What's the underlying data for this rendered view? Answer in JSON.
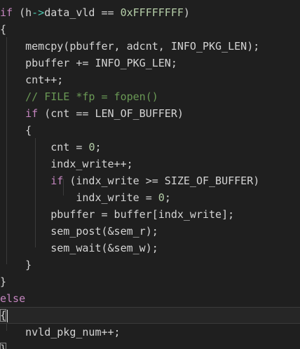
{
  "editor": {
    "lines": [
      {
        "kw": "if",
        "text": " (h",
        "arrow": "->",
        "text2": "data_vld == ",
        "num": "0xFFFFFFFF",
        "text3": ")"
      },
      {
        "text": "{"
      },
      {
        "text": "    memcpy(pbuffer, adcnt, INFO_PKG_LEN);"
      },
      {
        "text": "    pbuffer += INFO_PKG_LEN;"
      },
      {
        "text": "    cnt++;"
      },
      {
        "comment": "    // FILE *fp = fopen()"
      },
      {
        "indent": "    ",
        "kw": "if",
        "text": " (cnt == LEN_OF_BUFFER)"
      },
      {
        "text": "    {"
      },
      {
        "text": "        cnt = ",
        "num": "0",
        "text2": ";"
      },
      {
        "text": "        indx_write++;"
      },
      {
        "indent": "        ",
        "kw": "if",
        "text": " (indx_write >= SIZE_OF_BUFFER)"
      },
      {
        "text": "            indx_write = ",
        "num": "0",
        "text2": ";"
      },
      {
        "text": "        pbuffer = buffer[indx_write];"
      },
      {
        "text": "        sem_post(&sem_r);"
      },
      {
        "text": "        sem_wait(&sem_w);"
      },
      {
        "text": "    }"
      },
      {
        "text": "}"
      },
      {
        "kw": "else"
      },
      {
        "brace": "{"
      },
      {
        "text": "    nvld_pkg_num++;"
      },
      {
        "brace": "}"
      }
    ]
  },
  "colors": {
    "background": "#1f1f1f",
    "text": "#d4d4d4",
    "keyword": "#c586c0",
    "number": "#b5cea8",
    "comment": "#6a9955",
    "arrow": "#4ec9b0"
  }
}
